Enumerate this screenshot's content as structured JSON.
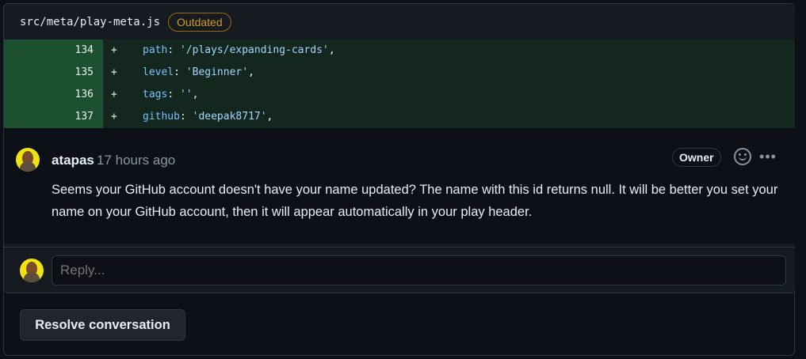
{
  "file": {
    "path": "src/meta/play-meta.js",
    "status_badge": "Outdated"
  },
  "diff": {
    "lines": [
      {
        "number": "134",
        "sign": "+",
        "key": "path",
        "value": "'/plays/expanding-cards'"
      },
      {
        "number": "135",
        "sign": "+",
        "key": "level",
        "value": "'Beginner'"
      },
      {
        "number": "136",
        "sign": "+",
        "key": "tags",
        "value": "''"
      },
      {
        "number": "137",
        "sign": "+",
        "key": "github",
        "value": "'deepak8717'"
      }
    ]
  },
  "comment": {
    "author": "atapas",
    "time": "17 hours ago",
    "role_badge": "Owner",
    "body": "Seems your GitHub account doesn't have your name updated? The name with this id returns null. It will be better you set your name on your GitHub account, then it will appear automatically in your play header.",
    "reaction_icon": "smiley-icon",
    "more_icon": "kebab-horizontal-icon",
    "more_glyph": "•••"
  },
  "reply": {
    "placeholder": "Reply..."
  },
  "actions": {
    "resolve_label": "Resolve conversation"
  },
  "colors": {
    "background": "#0d1117",
    "panel": "#161b22",
    "border": "#30363d",
    "outdated": "#d29922",
    "diff_added_line": "#1d5030",
    "diff_added_code": "#13271f",
    "avatar_bg": "#f0e313"
  }
}
